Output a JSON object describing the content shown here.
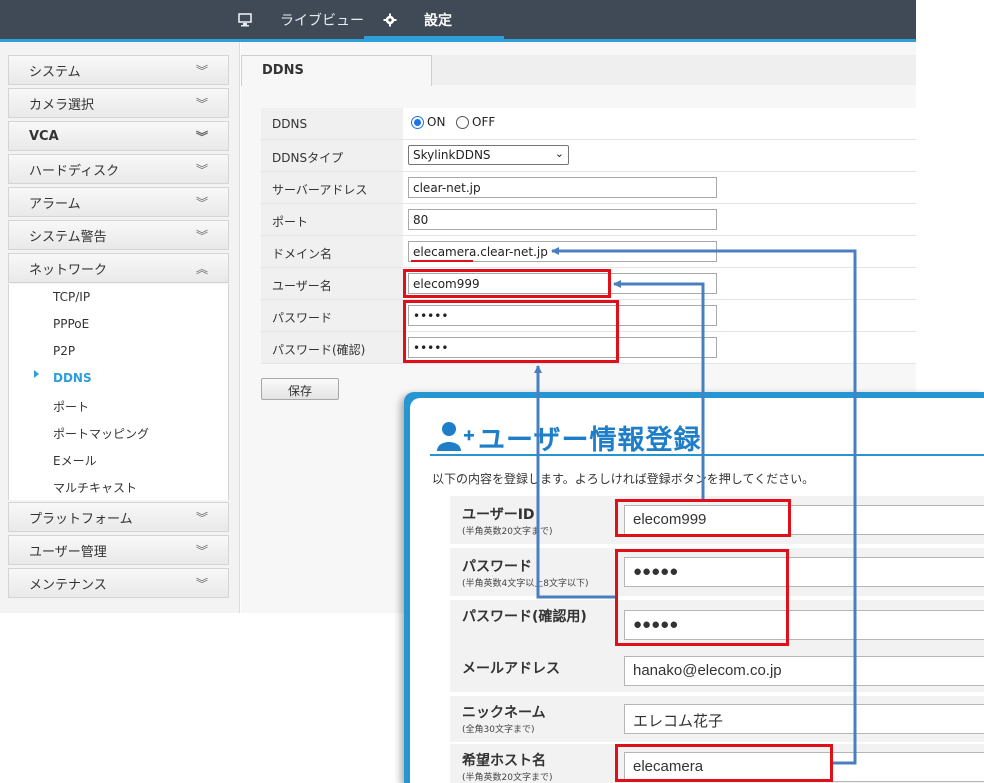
{
  "topbar": {
    "live_view_label": "ライブビュー",
    "settings_label": "設定",
    "accent_color": "#2e9fd8"
  },
  "sidebar": {
    "groups": [
      {
        "label": "システム",
        "expanded": false
      },
      {
        "label": "カメラ選択",
        "expanded": false
      },
      {
        "label": "VCA",
        "expanded": false
      },
      {
        "label": "ハードディスク",
        "expanded": false
      },
      {
        "label": "アラーム",
        "expanded": false
      },
      {
        "label": "システム警告",
        "expanded": false
      },
      {
        "label": "ネットワーク",
        "expanded": true
      },
      {
        "label": "プラットフォーム",
        "expanded": false
      },
      {
        "label": "ユーザー管理",
        "expanded": false
      },
      {
        "label": "メンテナンス",
        "expanded": false
      }
    ],
    "network_items": [
      "TCP/IP",
      "PPPoE",
      "P2P",
      "DDNS",
      "ポート",
      "ポートマッピング",
      "Eメール",
      "マルチキャスト"
    ],
    "active_item": "DDNS"
  },
  "main": {
    "tab_label": "DDNS",
    "rows": {
      "ddns": {
        "label": "DDNS",
        "on_label": "ON",
        "off_label": "OFF",
        "selected": "ON"
      },
      "type": {
        "label": "DDNSタイプ",
        "value": "SkylinkDDNS"
      },
      "server": {
        "label": "サーバーアドレス",
        "value": "clear-net.jp"
      },
      "port": {
        "label": "ポート",
        "value": "80"
      },
      "domain": {
        "label": "ドメイン名",
        "value": "elecamera.clear-net.jp"
      },
      "user": {
        "label": "ユーザー名",
        "value": "elecom999"
      },
      "password": {
        "label": "パスワード",
        "value": "•••••"
      },
      "password_confirm": {
        "label": "パスワード(確認)",
        "value": "•••••"
      }
    },
    "save_label": "保存"
  },
  "registration": {
    "title": "ユーザー情報登録",
    "description": "以下の内容を登録します。よろしければ登録ボタンを押してください。",
    "fields": {
      "user_id": {
        "label": "ユーザーID",
        "hint": "(半角英数20文字まで)",
        "value": "elecom999"
      },
      "password": {
        "label": "パスワード",
        "hint": "(半角英数4文字以上8文字以下)",
        "value": "●●●●●"
      },
      "password_confirm": {
        "label": "パスワード(確認用)",
        "value": "●●●●●"
      },
      "email": {
        "label": "メールアドレス",
        "value": "hanako@elecom.co.jp"
      },
      "nickname": {
        "label": "ニックネーム",
        "hint": "(全角30文字まで)",
        "value": "エレコム花子"
      },
      "hostname": {
        "label": "希望ホスト名",
        "hint": "(半角英数20文字まで)",
        "value": "elecamera"
      }
    },
    "highlight_color": "#e0101a",
    "arrow_color": "#4a7fbf"
  }
}
